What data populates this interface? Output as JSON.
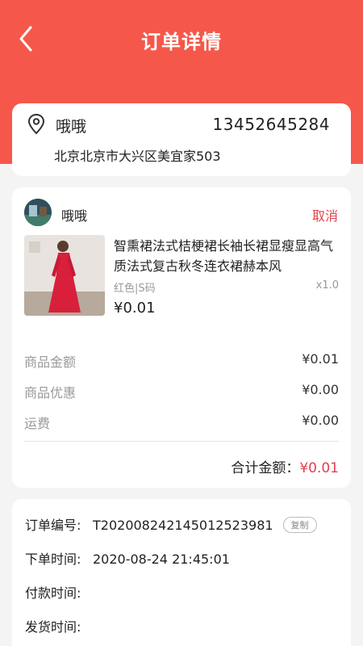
{
  "header": {
    "title": "订单详情",
    "back_icon": "chevron-left-icon",
    "bg_color": "#f5584a"
  },
  "address": {
    "icon": "location-pin-icon",
    "name": "哦哦",
    "phone": "13452645284",
    "detail": "北京北京市大兴区美宜家503"
  },
  "order": {
    "shop_name": "哦哦",
    "action_label": "取消",
    "product": {
      "title": "智熏裙法式桔梗裙长袖长裙显瘦显高气质法式复古秋冬连衣裙赫本风",
      "spec": "红色|S码",
      "qty": "x1.0",
      "price": "¥0.01"
    },
    "summary": [
      {
        "label": "商品金额",
        "value": "¥0.01"
      },
      {
        "label": "商品优惠",
        "value": "¥0.00"
      },
      {
        "label": "运费",
        "value": "¥0.00"
      }
    ],
    "total_label": "合计金额：",
    "total_value": "¥0.01",
    "accent_color": "#e3404c"
  },
  "info": {
    "order_no_label": "订单编号:",
    "order_no": "T202008242145012523981",
    "copy_label": "复制",
    "order_time_label": "下单时间:",
    "order_time": "2020-08-24 21:45:01",
    "pay_time_label": "付款时间:",
    "ship_time_label": "发货时间:"
  }
}
